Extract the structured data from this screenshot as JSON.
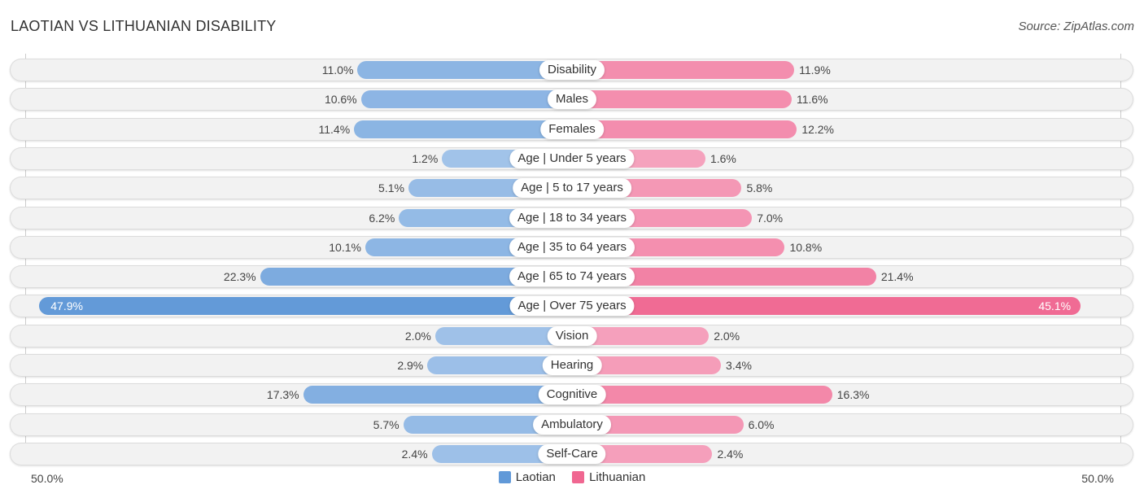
{
  "header": {
    "title": "LAOTIAN VS LITHUANIAN DISABILITY",
    "source": "Source: ZipAtlas.com"
  },
  "colors": {
    "laotian": "#6199d8",
    "laotian_light": "#a9c8eb",
    "lithuanian": "#f06791",
    "lithuanian_light": "#f6aac3"
  },
  "axis": {
    "left_label": "50.0%",
    "right_label": "50.0%"
  },
  "legend": {
    "laotian": "Laotian",
    "lithuanian": "Lithuanian"
  },
  "chart_data": {
    "type": "bar",
    "orientation": "horizontal-diverging",
    "title": "LAOTIAN VS LITHUANIAN DISABILITY",
    "xlim": [
      -50,
      50
    ],
    "unit": "%",
    "legend_position": "bottom-center",
    "categories": [
      "Disability",
      "Males",
      "Females",
      "Age | Under 5 years",
      "Age | 5 to 17 years",
      "Age | 18 to 34 years",
      "Age | 35 to 64 years",
      "Age | 65 to 74 years",
      "Age | Over 75 years",
      "Vision",
      "Hearing",
      "Cognitive",
      "Ambulatory",
      "Self-Care"
    ],
    "series": [
      {
        "name": "Laotian",
        "side": "left",
        "values": [
          11.0,
          10.6,
          11.4,
          1.2,
          5.1,
          6.2,
          10.1,
          22.3,
          47.9,
          2.0,
          2.9,
          17.3,
          5.7,
          2.4
        ],
        "labels": [
          "11.0%",
          "10.6%",
          "11.4%",
          "1.2%",
          "5.1%",
          "6.2%",
          "10.1%",
          "22.3%",
          "47.9%",
          "2.0%",
          "2.9%",
          "17.3%",
          "5.7%",
          "2.4%"
        ]
      },
      {
        "name": "Lithuanian",
        "side": "right",
        "values": [
          11.9,
          11.6,
          12.2,
          1.6,
          5.8,
          7.0,
          10.8,
          21.4,
          45.1,
          2.0,
          3.4,
          16.3,
          6.0,
          2.4
        ],
        "labels": [
          "11.9%",
          "11.6%",
          "12.2%",
          "1.6%",
          "5.8%",
          "7.0%",
          "10.8%",
          "21.4%",
          "45.1%",
          "2.0%",
          "3.4%",
          "16.3%",
          "6.0%",
          "2.4%"
        ]
      }
    ]
  }
}
